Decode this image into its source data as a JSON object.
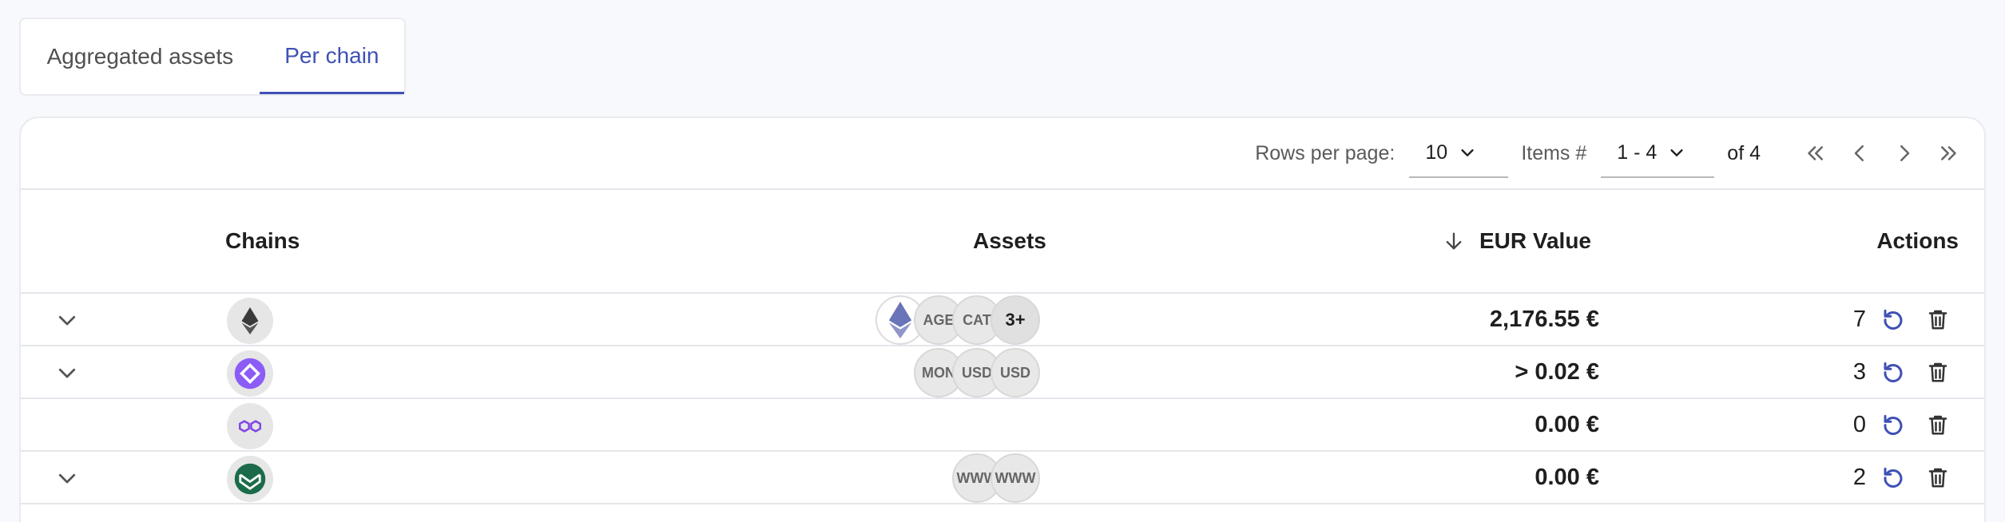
{
  "tabs": [
    {
      "label": "Aggregated assets",
      "active": false
    },
    {
      "label": "Per chain",
      "active": true
    }
  ],
  "pagination": {
    "rows_per_page_label": "Rows per page:",
    "rows_per_page_value": "10",
    "items_label": "Items #",
    "items_range": "1 - 4",
    "of_label": "of 4"
  },
  "table": {
    "headers": {
      "chains": "Chains",
      "assets": "Assets",
      "eur_value": "EUR Value",
      "actions": "Actions"
    },
    "rows": [
      {
        "chain_icon": "ethereum-icon",
        "expandable": true,
        "assets": [
          "ETH-icon",
          "AGE",
          "CAT",
          "3+"
        ],
        "eur_value": "2,176.55 €",
        "count": "7"
      },
      {
        "chain_icon": "gnosis-icon",
        "expandable": true,
        "assets": [
          "MON",
          "USD",
          "USD"
        ],
        "eur_value": "> 0.02 €",
        "count": "3"
      },
      {
        "chain_icon": "polygon-icon",
        "expandable": false,
        "assets": [],
        "eur_value": "0.00 €",
        "count": "0"
      },
      {
        "chain_icon": "green-chain-icon",
        "expandable": true,
        "assets": [
          "WWW",
          "WWW"
        ],
        "eur_value": "0.00 €",
        "count": "2"
      }
    ]
  },
  "colors": {
    "accent": "#3f51b5",
    "background": "#f8f9fc",
    "border": "#e4e6eb"
  }
}
